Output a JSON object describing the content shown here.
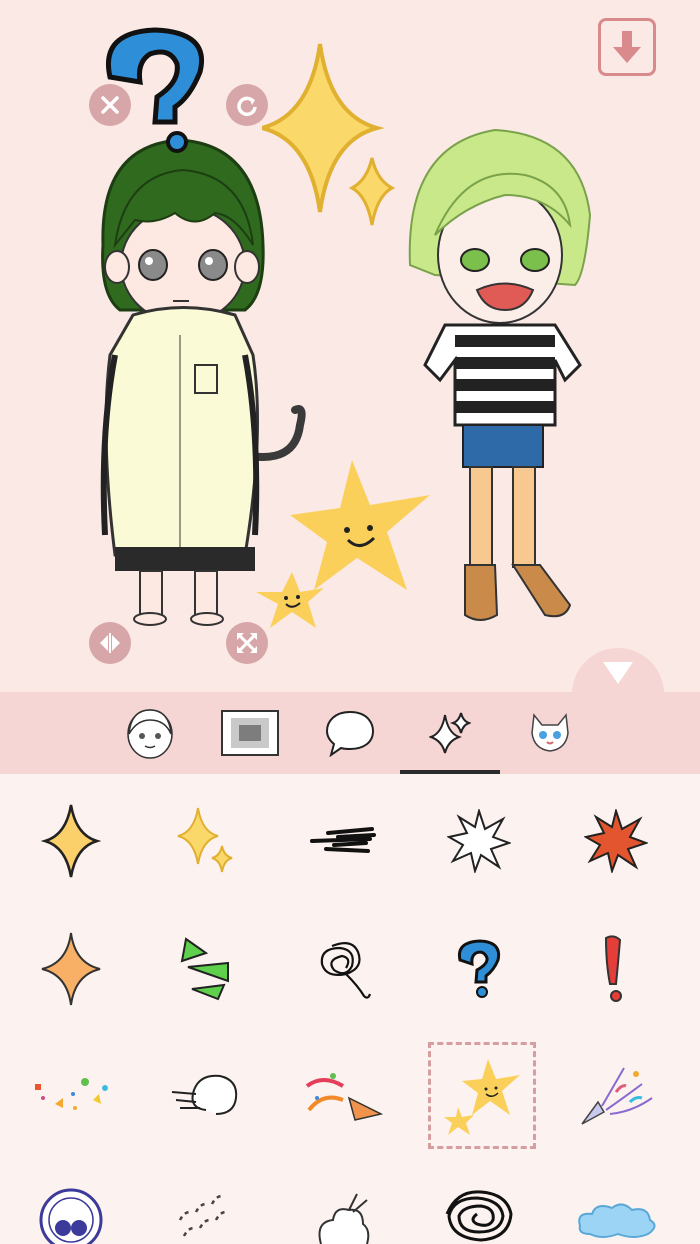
{
  "canvas": {
    "icons": {
      "save": "download-arrow-icon",
      "delete": "close-icon",
      "rotate": "rotate-icon",
      "flip": "flip-icon",
      "resize": "resize-icon",
      "collapse": "triangle-down-icon"
    },
    "stickers_on_canvas": [
      "question-mark",
      "sparkles",
      "smiling-stars"
    ]
  },
  "tabs": [
    {
      "id": "character",
      "icon": "character-face-icon"
    },
    {
      "id": "background",
      "icon": "background-frame-icon"
    },
    {
      "id": "speech",
      "icon": "speech-bubble-icon"
    },
    {
      "id": "effects",
      "icon": "sparkle-icon",
      "selected": true
    },
    {
      "id": "pets",
      "icon": "cat-icon"
    }
  ],
  "stickers": [
    "yellow-sparkle",
    "twin-sparkles",
    "speed-lines",
    "white-burst",
    "red-burst",
    "orange-sparkle",
    "green-shards",
    "scribble-knot",
    "blue-question-mark",
    "red-exclamation",
    "confetti-dots",
    "wind-puff",
    "party-popper",
    "smiling-stars",
    "confetti-streamers",
    "circle-stamp",
    "dash-lines",
    "smoke-puff",
    "black-scribble",
    "blue-cloud"
  ],
  "selected_sticker": "smiling-stars",
  "colors": {
    "canvas_bg": "#fbe9e6",
    "tabbar_bg": "#f6d6d4",
    "accent": "#d98a8c",
    "grid_bg": "#fcf2ef"
  }
}
